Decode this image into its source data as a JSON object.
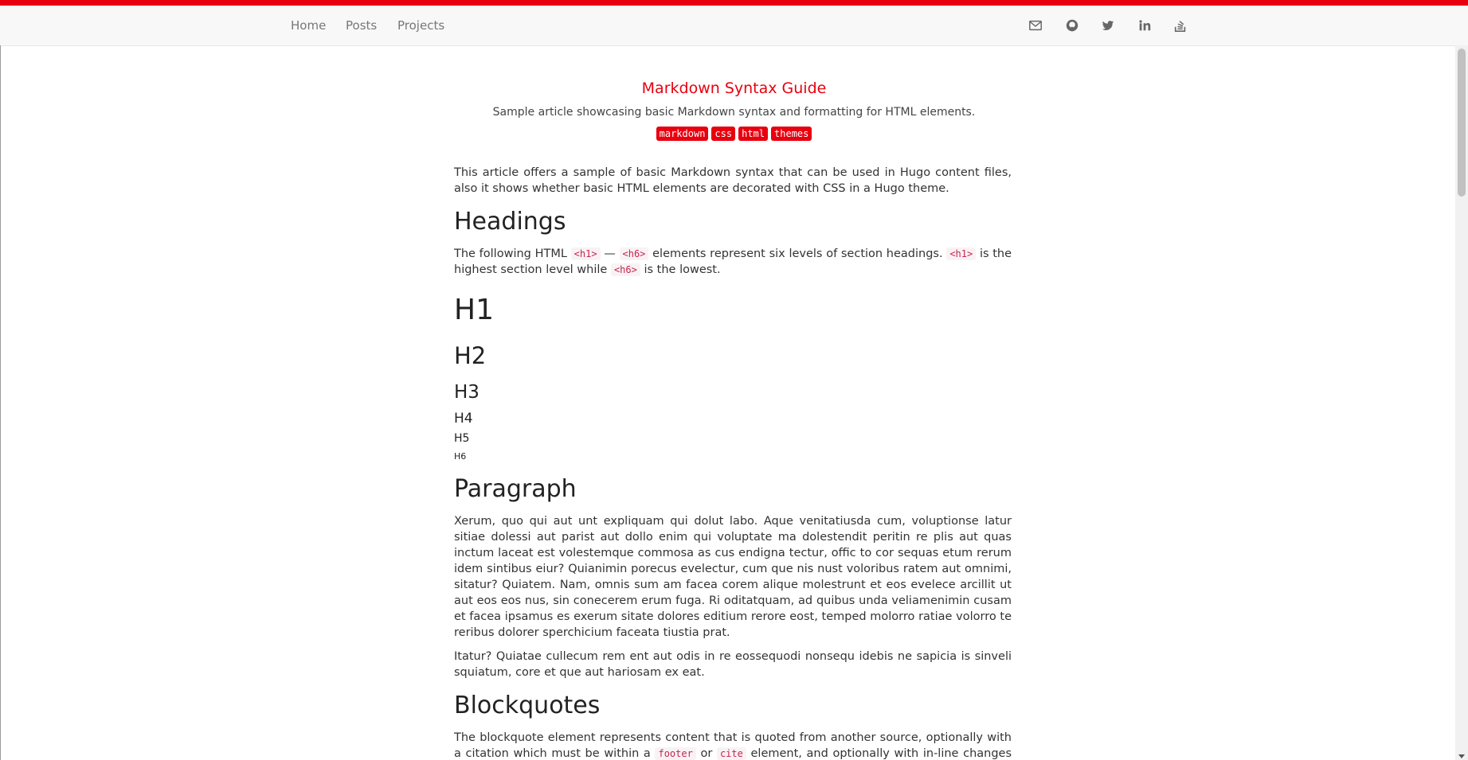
{
  "nav": {
    "links": [
      "Home",
      "Posts",
      "Projects"
    ],
    "social_icons": [
      "email-icon",
      "github-icon",
      "twitter-icon",
      "linkedin-icon",
      "stackoverflow-icon"
    ]
  },
  "colors": {
    "accent": "#e8000f",
    "code_text": "#c7254e",
    "code_bg": "#f9f2f4"
  },
  "article": {
    "title": "Markdown Syntax Guide",
    "subtitle": "Sample article showcasing basic Markdown syntax and formatting for HTML elements.",
    "tags": [
      "markdown",
      "css",
      "html",
      "themes"
    ],
    "intro": "This article offers a sample of basic Markdown syntax that can be used in Hugo content files, also it shows whether basic HTML elements are decorated with CSS in a Hugo theme.",
    "sections": {
      "headings": {
        "title": "Headings",
        "p_start": "The following HTML",
        "code1": "<h1>",
        "dash": "—",
        "code2": "<h6>",
        "p_mid": "elements represent six levels of section headings.",
        "code3": "<h1>",
        "p_mid2": "is the highest section level while",
        "code4": "<h6>",
        "p_end": "is the lowest.",
        "samples": [
          "H1",
          "H2",
          "H3",
          "H4",
          "H5",
          "H6"
        ]
      },
      "paragraph": {
        "title": "Paragraph",
        "p1": "Xerum, quo qui aut unt expliquam qui dolut labo. Aque venitatiusda cum, voluptionse latur sitiae dolessi aut parist aut dollo enim qui voluptate ma dolestendit peritin re plis aut quas inctum laceat est volestemque commosa as cus endigna tectur, offic to cor sequas etum rerum idem sintibus eiur? Quianimin porecus evelectur, cum que nis nust voloribus ratem aut omnimi, sitatur? Quiatem. Nam, omnis sum am facea corem alique molestrunt et eos evelece arcillit ut aut eos eos nus, sin conecerem erum fuga. Ri oditatquam, ad quibus unda veliamenimin cusam et facea ipsamus es exerum sitate dolores editium rerore eost, temped molorro ratiae volorro te reribus dolorer sperchicium faceata tiustia prat.",
        "p2": "Itatur? Quiatae cullecum rem ent aut odis in re eossequodi nonsequ idebis ne sapicia is sinveli squiatum, core et que aut hariosam ex eat."
      },
      "blockquotes": {
        "title": "Blockquotes",
        "p_start": "The blockquote element represents content that is quoted from another source, optionally with a citation which must be within a",
        "code1": "footer",
        "p_or": "or",
        "code2": "cite",
        "p_end": "element, and optionally with in-line changes such as annotations and abbreviations."
      }
    }
  }
}
